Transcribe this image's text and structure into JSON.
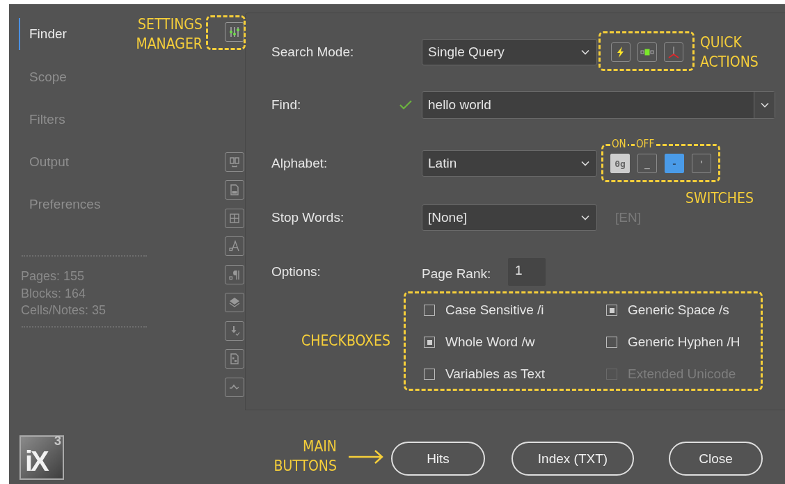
{
  "sidebar": {
    "items": [
      {
        "label": "Finder",
        "selected": true
      },
      {
        "label": "Scope",
        "selected": false
      },
      {
        "label": "Filters",
        "selected": false
      },
      {
        "label": "Output",
        "selected": false
      },
      {
        "label": "Preferences",
        "selected": false
      }
    ],
    "stats": [
      "Pages: 155",
      "Blocks: 164",
      "Cells/Notes: 35"
    ],
    "logo": {
      "text": "iX",
      "superscript": "3"
    }
  },
  "form": {
    "search_mode": {
      "label": "Search Mode:",
      "value": "Single Query"
    },
    "find": {
      "label": "Find:",
      "value": "hello world",
      "valid": true
    },
    "alphabet": {
      "label": "Alphabet:",
      "value": "Latin"
    },
    "switches": [
      {
        "text": "0g",
        "on": true,
        "highlighted": false
      },
      {
        "text": "_",
        "on": false,
        "highlighted": false
      },
      {
        "text": "-",
        "on": false,
        "highlighted": true
      },
      {
        "text": "'",
        "on": false,
        "highlighted": false
      }
    ],
    "stop_words": {
      "label": "Stop Words:",
      "value": "[None]",
      "language": "[EN]"
    },
    "options": {
      "label": "Options:",
      "page_rank_label": "Page Rank:",
      "page_rank": "1"
    },
    "checkboxes": [
      {
        "label": "Case Sensitive /i",
        "checked": false,
        "disabled": false
      },
      {
        "label": "Generic Space /s",
        "checked": true,
        "disabled": false
      },
      {
        "label": "Whole Word /w",
        "checked": true,
        "disabled": false
      },
      {
        "label": "Generic Hyphen /H",
        "checked": false,
        "disabled": false
      },
      {
        "label": "Variables as Text",
        "checked": false,
        "disabled": false
      },
      {
        "label": "Extended Unicode",
        "checked": false,
        "disabled": true
      }
    ]
  },
  "buttons": [
    "Hits",
    "Index (TXT)",
    "Close"
  ],
  "annotations": {
    "settings_manager": "SETTINGS MANAGER",
    "quick_actions": "QUICK ACTIONS",
    "switch_on": "ON",
    "switch_off": "OFF",
    "switches": "SWITCHES",
    "checkboxes": "CHECKBOXES",
    "main_buttons": "MAIN BUTTONS"
  }
}
